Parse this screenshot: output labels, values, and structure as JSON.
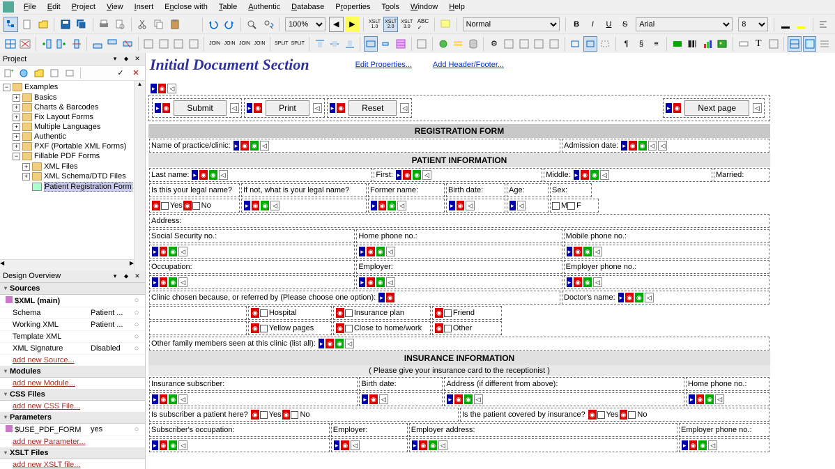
{
  "menu": [
    "File",
    "Edit",
    "Project",
    "View",
    "Insert",
    "Enclose with",
    "Table",
    "Authentic",
    "Database",
    "Properties",
    "Tools",
    "Window",
    "Help"
  ],
  "toolbar1": {
    "zoom": "100%",
    "style_sel": "Normal",
    "font": "Arial",
    "size": "8",
    "xslt_labels": [
      "XSLT 1.0",
      "XSLT 2.0",
      "XSLT 3.0"
    ]
  },
  "project": {
    "title": "Project",
    "root": "Examples",
    "items": [
      "Basics",
      "Charts & Barcodes",
      "Fix Layout Forms",
      "Multiple Languages",
      "Authentic",
      "PXF (Portable XML Forms)",
      "Fillable PDF Forms"
    ],
    "subitems": [
      "XML Files",
      "XML Schema/DTD Files",
      "Patient Registration Form"
    ]
  },
  "overview": {
    "title": "Design Overview",
    "sources_label": "Sources",
    "xml_main": "$XML (main)",
    "rows": [
      {
        "a": "Schema",
        "b": "Patient ..."
      },
      {
        "a": "Working XML",
        "b": "Patient ..."
      },
      {
        "a": "Template XML",
        "b": ""
      },
      {
        "a": "XML Signature",
        "b": "Disabled"
      }
    ],
    "add_source": "add new Source...",
    "modules_label": "Modules",
    "add_module": "add new Module...",
    "css_label": "CSS Files",
    "add_css": "add new CSS File...",
    "params_label": "Parameters",
    "param_row": {
      "a": "$USE_PDF_FORM",
      "b": "yes"
    },
    "add_param": "add new Parameter...",
    "xslt_label": "XSLT Files",
    "add_xslt": "add new XSLT file..."
  },
  "canvas": {
    "section_title": "Initial Document Section",
    "link_edit": "Edit Properties...",
    "link_header": "Add Header/Footer...",
    "btn_submit": "Submit",
    "btn_print": "Print",
    "btn_reset": "Reset",
    "btn_next": "Next page",
    "hdr_reg": "REGISTRATION FORM",
    "hdr_patient": "PATIENT INFORMATION",
    "hdr_ins": "INSURANCE INFORMATION",
    "hdr_ins_sub": "( Please give your insurance card to the receptionist )",
    "labels": {
      "practice": "Name of practice/clinic:",
      "admission": "Admission date:",
      "last": "Last name:",
      "first": "First:",
      "middle": "Middle:",
      "married": "Married:",
      "legal_q": "Is this your legal name?",
      "legal_ifnot": "If not, what is your legal name?",
      "former": "Former name:",
      "birth": "Birth date:",
      "age": "Age:",
      "sex": "Sex:",
      "yes": "Yes",
      "no": "No",
      "m": "M",
      "f": "F",
      "address": "Address:",
      "ssn": "Social Security no.:",
      "homephone": "Home phone no.:",
      "mobile": "Mobile phone no.:",
      "occupation": "Occupation:",
      "employer": "Employer:",
      "emp_phone": "Employer phone no.:",
      "clinic_ref": "Clinic chosen because, or referred by (Please choose one option):",
      "doctor": "Doctor's name:",
      "hospital": "Hospital",
      "ins_plan": "Insurance plan",
      "friend": "Friend",
      "yellow": "Yellow pages",
      "close_home": "Close to home/work",
      "other": "Other",
      "family": "Other family members seen at this clinic (list all):",
      "ins_sub": "Insurance subscriber:",
      "birth_date": "Birth date:",
      "addr_diff": "Address (if different from above):",
      "home_phone2": "Home phone no.:",
      "sub_patient_q": "Is subscriber a patient here?",
      "covered_q": "Is the patient covered by insurance?",
      "sub_occ": "Subscriber's occupation:",
      "employer2": "Employer:",
      "emp_addr": "Employer address:",
      "emp_phone2": "Employer phone no.:"
    }
  }
}
